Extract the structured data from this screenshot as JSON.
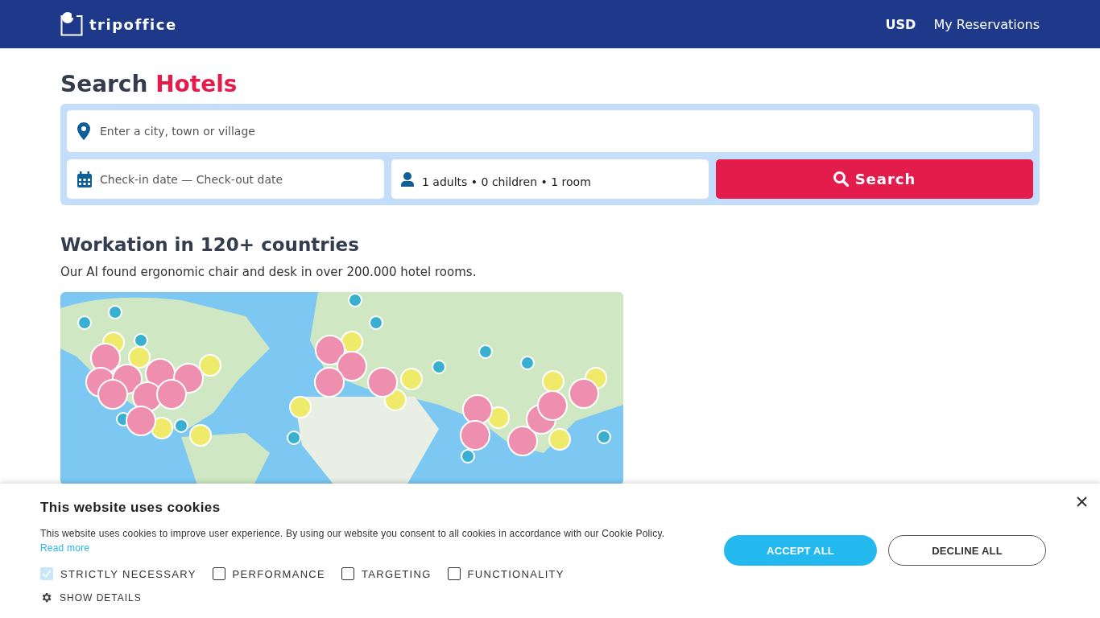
{
  "header": {
    "logo": "tripoffice",
    "nav": [
      {
        "label": "USD",
        "kind": "currency"
      },
      {
        "label": "My Reservations",
        "kind": "link"
      }
    ]
  },
  "search": {
    "title": "Search ",
    "title_accent": "Hotels",
    "destination": {
      "placeholder": "Enter a city, town or village"
    },
    "dates": {
      "placeholder": "Check-in date — Check-out date"
    },
    "guests": {
      "value": "1 adults • 0 children • 1 room"
    },
    "button": "Search"
  },
  "promo": {
    "title": "Workation in 120+ countries",
    "text": "Our AI found ergonomic chair and desk in over 200.000 hotel rooms."
  },
  "cookie_banner": {
    "title": "This website uses cookies",
    "text": "This website uses cookies to improve user experience. By using our website you consent to all cookies in accordance with our Cookie Policy.",
    "link": "Read more",
    "options": [
      {
        "label": "STRICTLY NECESSARY",
        "checked": true,
        "disabled": true
      },
      {
        "label": "PERFORMANCE",
        "checked": false,
        "disabled": false
      },
      {
        "label": "TARGETING",
        "checked": false,
        "disabled": false
      },
      {
        "label": "FUNCTIONALITY",
        "checked": false,
        "disabled": false
      }
    ],
    "details": "SHOW DETAILS",
    "accept": "ACCEPT ALL",
    "decline": "DECLINE ALL"
  }
}
